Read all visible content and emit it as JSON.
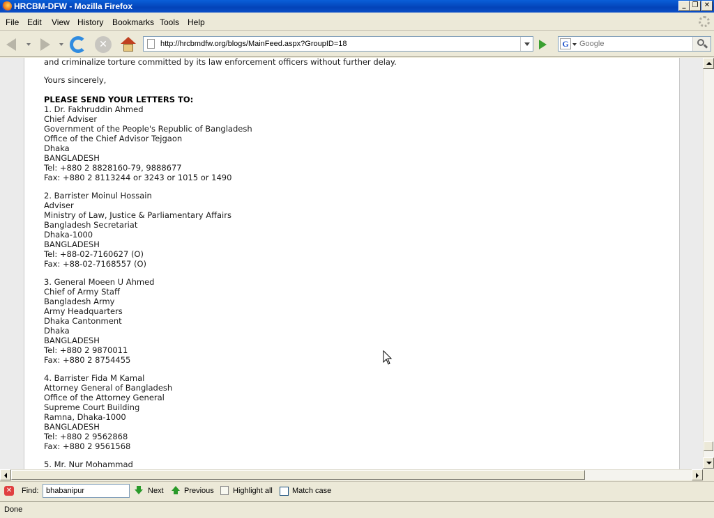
{
  "window": {
    "title": "HRCBM-DFW - Mozilla Firefox"
  },
  "menu": {
    "items": [
      "File",
      "Edit",
      "View",
      "History",
      "Bookmarks",
      "Tools",
      "Help"
    ]
  },
  "navigation": {
    "url": "http://hrcbmdfw.org/blogs/MainFeed.aspx?GroupID=18",
    "search_placeholder": "Google",
    "search_engine_icon": "google-icon"
  },
  "content": {
    "lines": [
      "and criminalize torture committed by its law enforcement officers without further delay.",
      "Yours sincerely,",
      "PLEASE SEND YOUR LETTERS TO:",
      "1. Dr. Fakhruddin Ahmed",
      "Chief Adviser",
      "Government of the People's Republic of Bangladesh",
      "Office of the Chief Advisor Tejgaon",
      "Dhaka",
      "BANGLADESH",
      "Tel: +880 2 8828160-79, 9888677",
      "Fax: +880 2 8113244 or 3243 or 1015 or 1490",
      "2. Barrister Moinul Hossain",
      "Adviser",
      "Ministry of Law, Justice & Parliamentary Affairs",
      "Bangladesh Secretariat",
      "Dhaka-1000",
      "BANGLADESH",
      "Tel: +88-02-7160627 (O)",
      "Fax: +88-02-7168557 (O)",
      "3. General Moeen U Ahmed",
      "Chief of Army Staff",
      "Bangladesh Army",
      "Army Headquarters",
      "Dhaka Cantonment",
      "Dhaka",
      "BANGLADESH",
      "Tel: +880 2 9870011",
      "Fax: +880 2 8754455",
      "4. Barrister Fida M Kamal",
      "Attorney General of Bangladesh",
      "Office of the Attorney General",
      "Supreme Court Building",
      "Ramna, Dhaka-1000",
      "BANGLADESH",
      "Tel: +880 2 9562868",
      "Fax: +880 2 9561568",
      "5. Mr. Nur Mohammad"
    ]
  },
  "findbar": {
    "label": "Find:",
    "query": "bhabanipur",
    "next": "Next",
    "previous": "Previous",
    "highlight_all": "Highlight all",
    "match_case": "Match case"
  },
  "status": {
    "text": "Done"
  }
}
